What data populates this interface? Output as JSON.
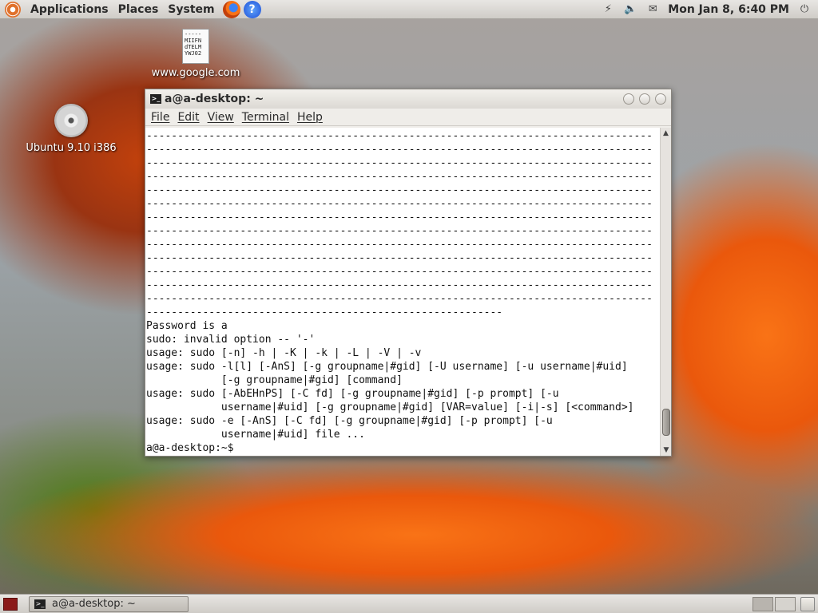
{
  "top_panel": {
    "menus": [
      "Applications",
      "Places",
      "System"
    ],
    "clock": "Mon Jan  8,  6:40 PM",
    "power_glyph": "⏻",
    "help_glyph": "?",
    "tray_icons": [
      "network-icon",
      "volume-icon",
      "mail-icon"
    ]
  },
  "desktop": {
    "file_icon": {
      "thumb_text": "-----\nMIIFN\ndTELM\nYWJ02",
      "label": "www.google.com"
    },
    "cd_icon": {
      "label": "Ubuntu 9.10 i386"
    }
  },
  "terminal": {
    "title": "a@a-desktop: ~",
    "menu": [
      "File",
      "Edit",
      "View",
      "Terminal",
      "Help"
    ],
    "lines": [
      "---------------------------------------------------------------------------------",
      "---------------------------------------------------------------------------------",
      "---------------------------------------------------------------------------------",
      "---------------------------------------------------------------------------------",
      "---------------------------------------------------------------------------------",
      "---------------------------------------------------------------------------------",
      "---------------------------------------------------------------------------------",
      "---------------------------------------------------------------------------------",
      "---------------------------------------------------------------------------------",
      "---------------------------------------------------------------------------------",
      "---------------------------------------------------------------------------------",
      "---------------------------------------------------------------------------------",
      "---------------------------------------------------------------------------------",
      "---------------------------------------------------------",
      "Password is a",
      "sudo: invalid option -- '-'",
      "usage: sudo [-n] -h | -K | -k | -L | -V | -v",
      "usage: sudo -l[l] [-AnS] [-g groupname|#gid] [-U username] [-u username|#uid]",
      "            [-g groupname|#gid] [command]",
      "usage: sudo [-AbEHnPS] [-C fd] [-g groupname|#gid] [-p prompt] [-u",
      "            username|#uid] [-g groupname|#gid] [VAR=value] [-i|-s] [<command>]",
      "usage: sudo -e [-AnS] [-C fd] [-g groupname|#gid] [-p prompt] [-u",
      "            username|#uid] file ...",
      "a@a-desktop:~$ "
    ]
  },
  "bottom_panel": {
    "task_label": "a@a-desktop: ~"
  }
}
